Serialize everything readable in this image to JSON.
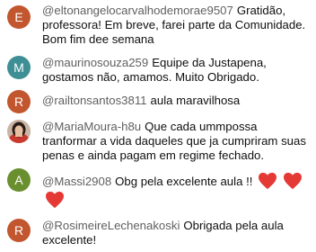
{
  "comments": [
    {
      "avatar_letter": "E",
      "avatar_color": "#c2572f",
      "handle": "@eltonangelocarvalhodemorae9507",
      "text": "Gratidão, professora! Em breve, farei parte da Comunidade. Bom fim dee semana"
    },
    {
      "avatar_letter": "M",
      "avatar_color": "#3e8f95",
      "handle": "@maurinosouza259",
      "text": "Equipe da Justapena, gostamos não, amamos. Muito Obrigado."
    },
    {
      "avatar_letter": "R",
      "avatar_color": "#c2572f",
      "handle": "@railtonsantos3811",
      "text": "aula maravilhosa"
    },
    {
      "avatar_icon": "user-photo",
      "handle": "@MariaMoura-h8u",
      "text": "Que cada ummpossa tranformar a vida daqueles que ja cumpriram suas penas e ainda pagam em regime fechado."
    },
    {
      "avatar_letter": "A",
      "avatar_color": "#6a8f2e",
      "handle": "@Massi2908",
      "text": "Obg pela excelente aula !!",
      "emoji_icon": "red-heart-emoji",
      "emoji_count": 3,
      "heart_color": "#e53935"
    },
    {
      "avatar_letter": "R",
      "avatar_color": "#c2572f",
      "handle": "@RosimeireLechenakoski",
      "text": "Obrigada pela aula excelente!"
    }
  ]
}
